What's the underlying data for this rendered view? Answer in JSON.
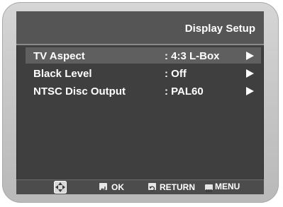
{
  "title": "Display Setup",
  "menu": {
    "items": [
      {
        "label": "TV Aspect",
        "value": ": 4:3 L-Box"
      },
      {
        "label": "Black Level",
        "value": ": Off"
      },
      {
        "label": "NTSC Disc Output",
        "value": ": PAL60"
      }
    ]
  },
  "footer": {
    "ok_label": "OK",
    "return_label": "RETURN",
    "menu_label": "MENU"
  },
  "colors": {
    "bezel": "#c8c8c8",
    "screen_bg": "#3f3f3f",
    "title_bar": "#555555",
    "highlight": "#5f5f5f",
    "text": "#ffffff"
  },
  "icons": [
    "dpad-icon",
    "enter-icon",
    "return-icon",
    "menu-icon",
    "arrow-right-icon"
  ]
}
